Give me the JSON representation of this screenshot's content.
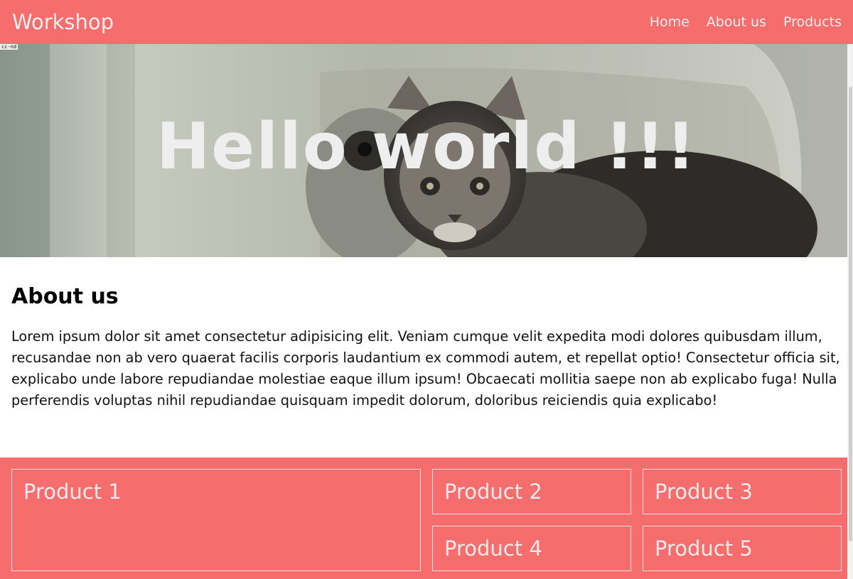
{
  "navbar": {
    "brand": "Workshop",
    "links": [
      "Home",
      "About us",
      "Products"
    ]
  },
  "hero": {
    "title": "Hello world !!!",
    "credit": "cc-nd",
    "image": "kitten-photo"
  },
  "about": {
    "heading": "About us",
    "body": "Lorem ipsum dolor sit amet consectetur adipisicing elit. Veniam cumque velit expedita modi dolores quibusdam illum, recusandae non ab vero quaerat facilis corporis laudantium ex commodi autem, et repellat optio! Consectetur officia sit, explicabo unde labore repudiandae molestiae eaque illum ipsum! Obcaecati mollitia saepe non ab explicabo fuga! Nulla perferendis voluptas nihil repudiandae quisquam impedit dolorum, doloribus reiciendis quia explicabo!"
  },
  "products": [
    "Product 1",
    "Product 2",
    "Product 3",
    "Product 4",
    "Product 5"
  ],
  "colors": {
    "accent": "#f66d6e",
    "nav_text": "#f3ecec",
    "hero_text": "#eeeeee"
  }
}
